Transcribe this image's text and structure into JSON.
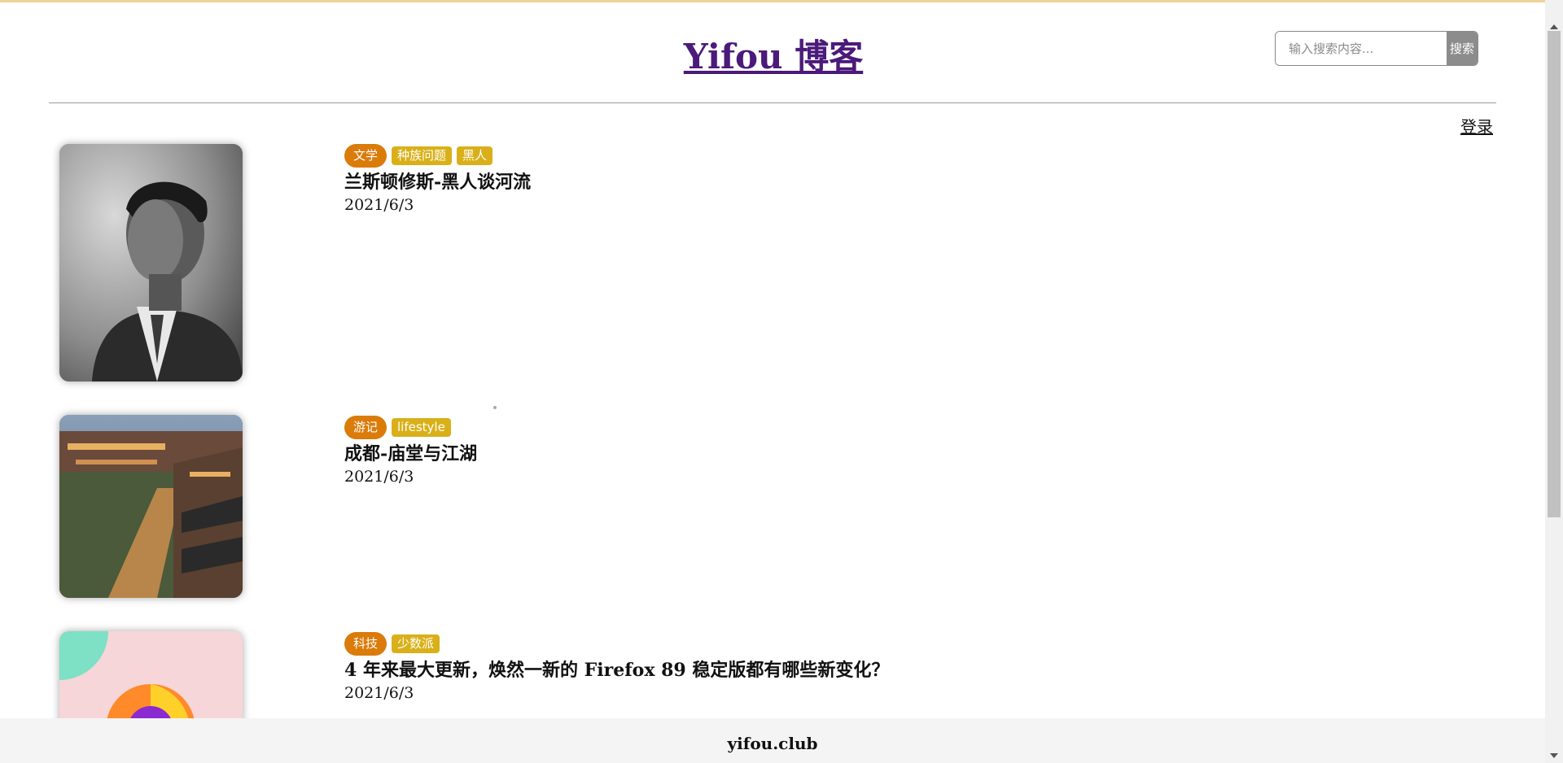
{
  "header": {
    "site_title": "Yifou 博客",
    "search_placeholder": "输入搜索内容...",
    "search_button": "搜索",
    "login": "登录"
  },
  "posts": [
    {
      "tags": [
        "文学",
        "种族问题",
        "黑人"
      ],
      "title": "兰斯顿修斯-黑人谈河流",
      "date": "2021/6/3",
      "thumbnail": "portrait-photo"
    },
    {
      "tags": [
        "游记",
        "lifestyle"
      ],
      "title": "成都-庙堂与江湖",
      "date": "2021/6/3",
      "thumbnail": "city-night-photo"
    },
    {
      "tags": [
        "科技",
        "少数派"
      ],
      "title": "4 年来最大更新，焕然一新的 Firefox 89 稳定版都有哪些新变化？",
      "date": "2021/6/3",
      "thumbnail": "firefox-logo-image"
    }
  ],
  "footer": {
    "text": "yifou.club"
  },
  "colors": {
    "title_link": "#4b1a7a",
    "primary_tag": "#da7b0a",
    "secondary_tag": "#d9b019",
    "search_button": "#8c8c8c",
    "top_accent": "#f0d49a"
  }
}
